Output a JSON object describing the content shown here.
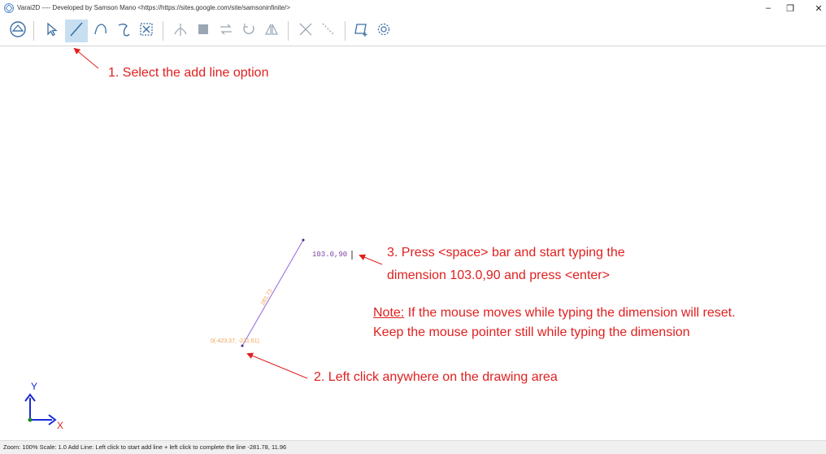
{
  "window": {
    "title": "Varai2D ---- Developed by Samson Mano <https://https://sites.google.com/site/samsoninfinite/>",
    "minimize_glyph": "–",
    "maximize_glyph": "❐",
    "close_glyph": "✕"
  },
  "toolbar": {
    "buttons": [
      {
        "name": "zoom-fit-icon",
        "active": false
      },
      {
        "name": "select-pointer-icon",
        "active": false
      },
      {
        "name": "add-line-icon",
        "active": true
      },
      {
        "name": "add-arc-icon",
        "active": false
      },
      {
        "name": "add-curve-icon",
        "active": false
      },
      {
        "name": "select-window-icon",
        "active": false
      },
      {
        "name": "trim-icon",
        "active": false
      },
      {
        "name": "fill-icon",
        "active": false
      },
      {
        "name": "offset-icon",
        "active": false
      },
      {
        "name": "rotate-icon",
        "active": false
      },
      {
        "name": "mirror-icon",
        "active": false
      },
      {
        "name": "delete-icon",
        "active": false
      },
      {
        "name": "dashed-line-icon",
        "active": false
      },
      {
        "name": "add-surface-icon",
        "active": false
      },
      {
        "name": "settings-gear-icon",
        "active": false
      }
    ]
  },
  "annotations": {
    "step1": "1. Select the add line option",
    "step2": "2. Left click anywhere on the drawing area",
    "step3_line1": "3. Press <space> bar and start typing the",
    "step3_line2": "dimension 103.0,90 and press <enter>",
    "note_label": "Note:",
    "note_line1": " If the mouse moves while typing the dimension will reset.",
    "note_line2": "Keep the mouse pointer still while typing the dimension",
    "color": "#e02020"
  },
  "drawing": {
    "dimension_input": "103.0,90",
    "start_coord_label": "0(-423.37, -231.61)",
    "length_label": "281.73",
    "line_color": "#9b6fe0",
    "label_color": "#f0a050"
  },
  "axes": {
    "x_label": "X",
    "y_label": "Y"
  },
  "status": {
    "text": "Zoom: 100%  Scale: 1.0    Add Line: Left click to start add line + left click to complete the line  -281.78, 11.96"
  }
}
